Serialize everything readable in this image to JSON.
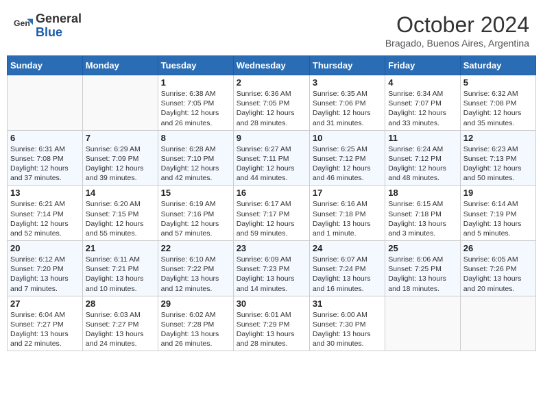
{
  "header": {
    "logo_general": "General",
    "logo_blue": "Blue",
    "title": "October 2024",
    "location": "Bragado, Buenos Aires, Argentina"
  },
  "days_of_week": [
    "Sunday",
    "Monday",
    "Tuesday",
    "Wednesday",
    "Thursday",
    "Friday",
    "Saturday"
  ],
  "weeks": [
    [
      {
        "day": "",
        "info": ""
      },
      {
        "day": "",
        "info": ""
      },
      {
        "day": "1",
        "info": "Sunrise: 6:38 AM\nSunset: 7:05 PM\nDaylight: 12 hours and 26 minutes."
      },
      {
        "day": "2",
        "info": "Sunrise: 6:36 AM\nSunset: 7:05 PM\nDaylight: 12 hours and 28 minutes."
      },
      {
        "day": "3",
        "info": "Sunrise: 6:35 AM\nSunset: 7:06 PM\nDaylight: 12 hours and 31 minutes."
      },
      {
        "day": "4",
        "info": "Sunrise: 6:34 AM\nSunset: 7:07 PM\nDaylight: 12 hours and 33 minutes."
      },
      {
        "day": "5",
        "info": "Sunrise: 6:32 AM\nSunset: 7:08 PM\nDaylight: 12 hours and 35 minutes."
      }
    ],
    [
      {
        "day": "6",
        "info": "Sunrise: 6:31 AM\nSunset: 7:08 PM\nDaylight: 12 hours and 37 minutes."
      },
      {
        "day": "7",
        "info": "Sunrise: 6:29 AM\nSunset: 7:09 PM\nDaylight: 12 hours and 39 minutes."
      },
      {
        "day": "8",
        "info": "Sunrise: 6:28 AM\nSunset: 7:10 PM\nDaylight: 12 hours and 42 minutes."
      },
      {
        "day": "9",
        "info": "Sunrise: 6:27 AM\nSunset: 7:11 PM\nDaylight: 12 hours and 44 minutes."
      },
      {
        "day": "10",
        "info": "Sunrise: 6:25 AM\nSunset: 7:12 PM\nDaylight: 12 hours and 46 minutes."
      },
      {
        "day": "11",
        "info": "Sunrise: 6:24 AM\nSunset: 7:12 PM\nDaylight: 12 hours and 48 minutes."
      },
      {
        "day": "12",
        "info": "Sunrise: 6:23 AM\nSunset: 7:13 PM\nDaylight: 12 hours and 50 minutes."
      }
    ],
    [
      {
        "day": "13",
        "info": "Sunrise: 6:21 AM\nSunset: 7:14 PM\nDaylight: 12 hours and 52 minutes."
      },
      {
        "day": "14",
        "info": "Sunrise: 6:20 AM\nSunset: 7:15 PM\nDaylight: 12 hours and 55 minutes."
      },
      {
        "day": "15",
        "info": "Sunrise: 6:19 AM\nSunset: 7:16 PM\nDaylight: 12 hours and 57 minutes."
      },
      {
        "day": "16",
        "info": "Sunrise: 6:17 AM\nSunset: 7:17 PM\nDaylight: 12 hours and 59 minutes."
      },
      {
        "day": "17",
        "info": "Sunrise: 6:16 AM\nSunset: 7:18 PM\nDaylight: 13 hours and 1 minute."
      },
      {
        "day": "18",
        "info": "Sunrise: 6:15 AM\nSunset: 7:18 PM\nDaylight: 13 hours and 3 minutes."
      },
      {
        "day": "19",
        "info": "Sunrise: 6:14 AM\nSunset: 7:19 PM\nDaylight: 13 hours and 5 minutes."
      }
    ],
    [
      {
        "day": "20",
        "info": "Sunrise: 6:12 AM\nSunset: 7:20 PM\nDaylight: 13 hours and 7 minutes."
      },
      {
        "day": "21",
        "info": "Sunrise: 6:11 AM\nSunset: 7:21 PM\nDaylight: 13 hours and 10 minutes."
      },
      {
        "day": "22",
        "info": "Sunrise: 6:10 AM\nSunset: 7:22 PM\nDaylight: 13 hours and 12 minutes."
      },
      {
        "day": "23",
        "info": "Sunrise: 6:09 AM\nSunset: 7:23 PM\nDaylight: 13 hours and 14 minutes."
      },
      {
        "day": "24",
        "info": "Sunrise: 6:07 AM\nSunset: 7:24 PM\nDaylight: 13 hours and 16 minutes."
      },
      {
        "day": "25",
        "info": "Sunrise: 6:06 AM\nSunset: 7:25 PM\nDaylight: 13 hours and 18 minutes."
      },
      {
        "day": "26",
        "info": "Sunrise: 6:05 AM\nSunset: 7:26 PM\nDaylight: 13 hours and 20 minutes."
      }
    ],
    [
      {
        "day": "27",
        "info": "Sunrise: 6:04 AM\nSunset: 7:27 PM\nDaylight: 13 hours and 22 minutes."
      },
      {
        "day": "28",
        "info": "Sunrise: 6:03 AM\nSunset: 7:27 PM\nDaylight: 13 hours and 24 minutes."
      },
      {
        "day": "29",
        "info": "Sunrise: 6:02 AM\nSunset: 7:28 PM\nDaylight: 13 hours and 26 minutes."
      },
      {
        "day": "30",
        "info": "Sunrise: 6:01 AM\nSunset: 7:29 PM\nDaylight: 13 hours and 28 minutes."
      },
      {
        "day": "31",
        "info": "Sunrise: 6:00 AM\nSunset: 7:30 PM\nDaylight: 13 hours and 30 minutes."
      },
      {
        "day": "",
        "info": ""
      },
      {
        "day": "",
        "info": ""
      }
    ]
  ]
}
